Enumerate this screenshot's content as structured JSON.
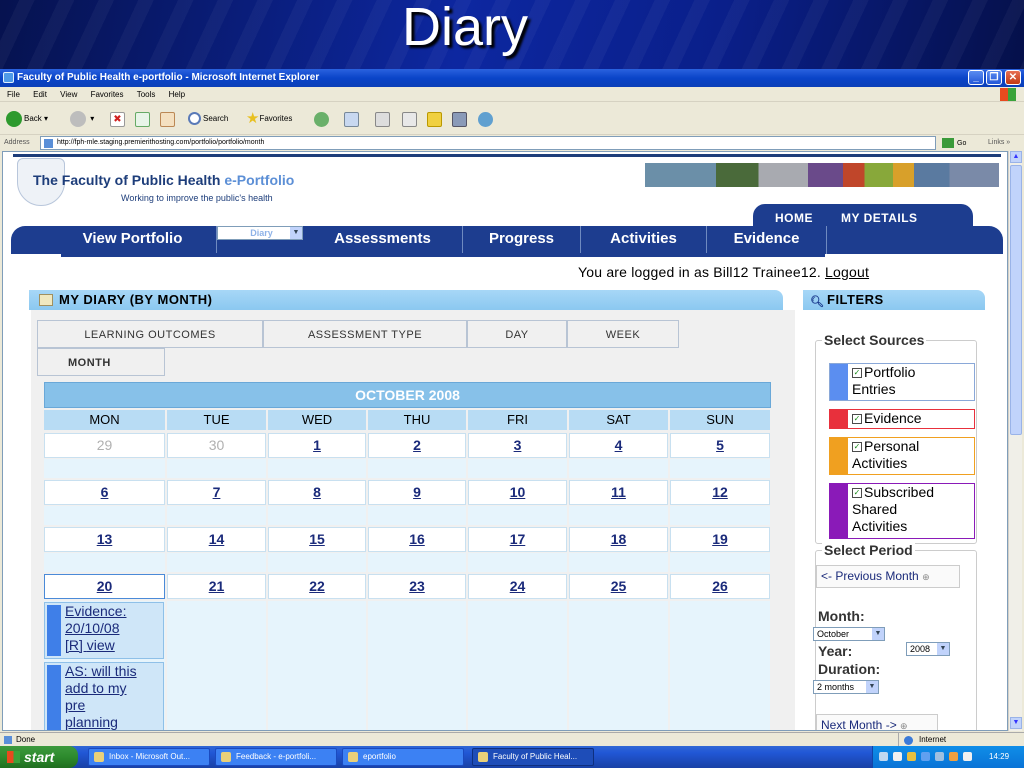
{
  "slide": {
    "title": "Diary"
  },
  "window": {
    "title": "Faculty of Public Health e-portfolio - Microsoft Internet Explorer"
  },
  "menu": [
    "File",
    "Edit",
    "View",
    "Favorites",
    "Tools",
    "Help"
  ],
  "toolbar": {
    "back": "Back",
    "search": "Search",
    "favorites": "Favorites"
  },
  "address": {
    "label": "Address",
    "url": "http://fph-mle.staging.premierithosting.com/portfolio/portfolio/month",
    "go": "Go",
    "links": "Links"
  },
  "site": {
    "title_main": "The Faculty of Public Health ",
    "title_accent": "e-Portfolio",
    "tagline": "Working to improve the public's health",
    "subnav": [
      "HOME",
      "MY DETAILS"
    ],
    "nav": [
      "View Portfolio",
      "Diary",
      "Assessments",
      "Progress",
      "Activities",
      "Evidence"
    ],
    "login_text": "You are logged in as Bill12 Trainee12. ",
    "logout": "Logout"
  },
  "diary": {
    "header": "MY DIARY (BY MONTH)",
    "tabs": [
      "LEARNING OUTCOMES",
      "ASSESSMENT TYPE",
      "DAY",
      "WEEK",
      "MONTH"
    ],
    "month_title": "OCTOBER 2008",
    "days_of_week": [
      "MON",
      "TUE",
      "WED",
      "THU",
      "FRI",
      "SAT",
      "SUN"
    ],
    "weeks": [
      [
        "29",
        "30",
        "1",
        "2",
        "3",
        "4",
        "5"
      ],
      [
        "6",
        "7",
        "8",
        "9",
        "10",
        "11",
        "12"
      ],
      [
        "13",
        "14",
        "15",
        "16",
        "17",
        "18",
        "19"
      ],
      [
        "20",
        "21",
        "22",
        "23",
        "24",
        "25",
        "26"
      ]
    ],
    "events": [
      {
        "line1": "Evidence:",
        "line2": "20/10/08",
        "line3": "[R] ",
        "link": "view"
      },
      {
        "line1": "AS: will this",
        "line2": "add to my",
        "line3": "pre",
        "line4": "planning"
      }
    ]
  },
  "filters": {
    "header": "FILTERS",
    "sources_title": "Select Sources",
    "sources": [
      {
        "line1": "Portfolio",
        "line2": "Entries",
        "color": "#5b8ef0"
      },
      {
        "line1": "Evidence",
        "color": "#e8303c"
      },
      {
        "line1": "Personal",
        "line2": "Activities",
        "color": "#f0a020"
      },
      {
        "line1": "Subscribed",
        "line2": "Shared",
        "line3": "Activities",
        "color": "#8a1ab8"
      }
    ],
    "period_title": "Select Period",
    "prev": "<- Previous Month",
    "month_label": "Month:",
    "month_value": "October",
    "year_label": "Year:",
    "year_value": "2008",
    "duration_label": "Duration:",
    "duration_value": "2 months",
    "next": "Next Month ->"
  },
  "status": {
    "left": "Done",
    "right": "Internet"
  },
  "taskbar": {
    "start": "start",
    "tasks": [
      "Inbox - Microsoft Out...",
      "Feedback - e-portfoli...",
      "eportfolio",
      "Faculty of Public Heal..."
    ],
    "clock": "14:29"
  }
}
